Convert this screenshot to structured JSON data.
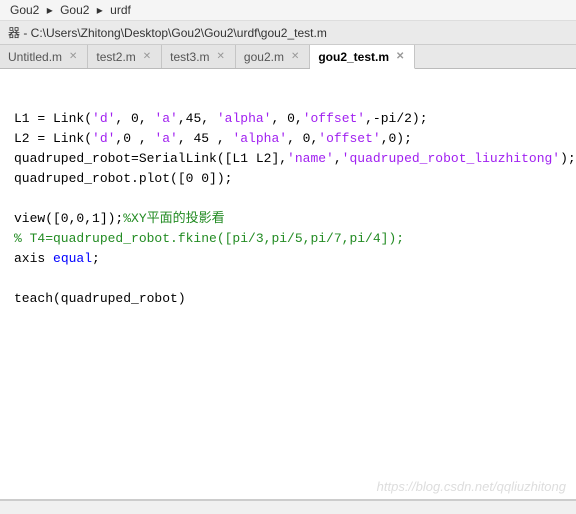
{
  "breadcrumb": {
    "sep": "▸",
    "items": [
      "Gou2",
      "Gou2",
      "urdf"
    ]
  },
  "titlebar": {
    "prefix": "器 - ",
    "path": "C:\\Users\\Zhitong\\Desktop\\Gou2\\Gou2\\urdf\\gou2_test.m"
  },
  "tabs": [
    {
      "label": "Untitled.m",
      "active": false
    },
    {
      "label": "test2.m",
      "active": false
    },
    {
      "label": "test3.m",
      "active": false
    },
    {
      "label": "gou2.m",
      "active": false
    },
    {
      "label": "gou2_test.m",
      "active": true
    }
  ],
  "code": {
    "l1a": "L1 = Link(",
    "l1s1": "'d'",
    "l1b": ", 0, ",
    "l1s2": "'a'",
    "l1c": ",45, ",
    "l1s3": "'alpha'",
    "l1d": ", 0,",
    "l1s4": "'offset'",
    "l1e": ",-pi/2);",
    "l2a": "L2 = Link(",
    "l2s1": "'d'",
    "l2b": ",0 , ",
    "l2s2": "'a'",
    "l2c": ", 45 , ",
    "l2s3": "'alpha'",
    "l2d": ", 0,",
    "l2s4": "'offset'",
    "l2e": ",0);",
    "l3a": "quadruped_robot=SerialLink([L1 L2],",
    "l3s1": "'name'",
    "l3b": ",",
    "l3s2": "'quadruped_robot_liuzhitong'",
    "l3c": ");",
    "l4": "quadruped_robot.plot([0 0]);",
    "l5a": "view([0,0,1]);",
    "l5c": "%XY平面的投影看",
    "l6c": "% T4=quadruped_robot.fkine([pi/3,pi/5,pi/7,pi/4]);",
    "l7a": "axis ",
    "l7k": "equal",
    "l7b": ";",
    "l8": "teach(quadruped_robot)"
  },
  "watermark": "https://blog.csdn.net/qqliuzhitong"
}
